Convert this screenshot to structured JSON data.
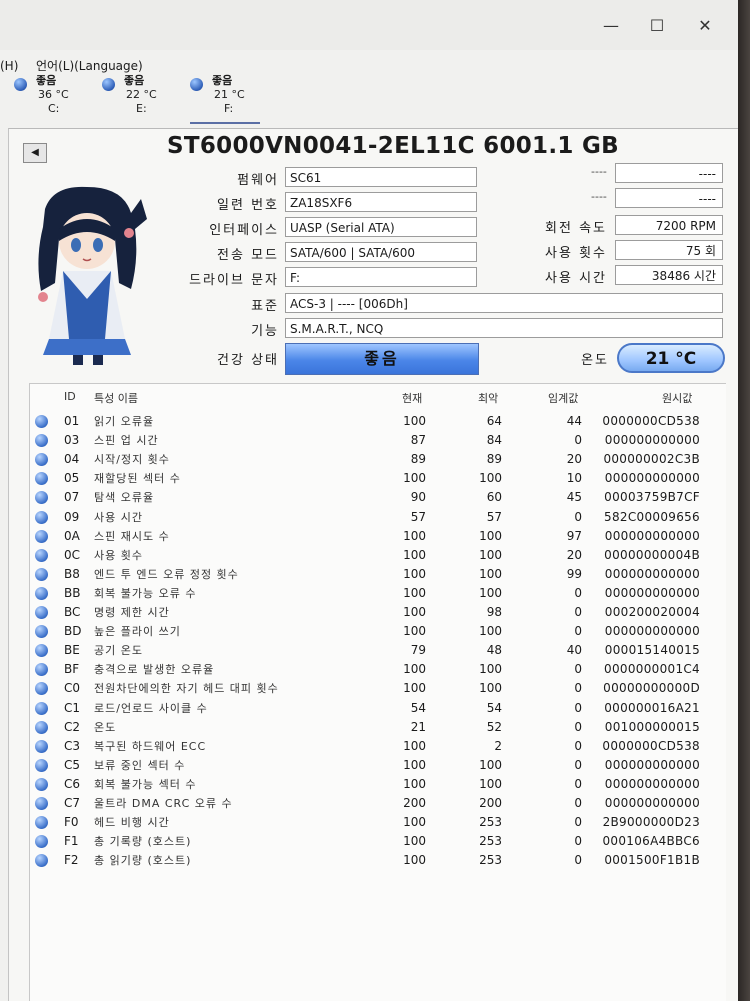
{
  "window": {
    "minimize": "—",
    "maximize": "☐",
    "close": "✕"
  },
  "menu": [
    {
      "label": "(H)"
    },
    {
      "label": "언어(L)(Language)"
    }
  ],
  "drives": [
    {
      "status": "좋음",
      "temp": "36 °C",
      "letter": "C:"
    },
    {
      "status": "좋음",
      "temp": "22 °C",
      "letter": "E:"
    },
    {
      "status": "좋음",
      "temp": "21 °C",
      "letter": "F:"
    }
  ],
  "disk": {
    "title": "ST6000VN0041-2EL11C 6001.1 GB",
    "firmware_label": "펌웨어",
    "firmware": "SC61",
    "serial_label": "일련 번호",
    "serial": "ZA18SXF6",
    "interface_label": "인터페이스",
    "interface": "UASP (Serial ATA)",
    "transfer_label": "전송 모드",
    "transfer": "SATA/600 | SATA/600",
    "drive_letter_label": "드라이브 문자",
    "drive_letter": "F:",
    "standard_label": "표준",
    "standard": "ACS-3 | ---- [006Dh]",
    "features_label": "기능",
    "features": "S.M.A.R.T., NCQ",
    "health_label": "건강 상태",
    "health": "좋음",
    "temp_label": "온도",
    "temp": "21 °C",
    "rpm_label": "회전 속도",
    "rpm": "7200 RPM",
    "power_on_count_label": "사용 횟수",
    "power_on_count": "75 회",
    "power_on_hours_label": "사용 시간",
    "power_on_hours": "38486 시간",
    "blank1_dash": "----",
    "blank1_value": "----",
    "blank2_dash": "----",
    "blank2_value": "----"
  },
  "table": {
    "headers": {
      "id": "ID",
      "name": "특성 이름",
      "current": "현재",
      "worst": "최악",
      "threshold": "임계값",
      "raw": "원시값"
    },
    "rows": [
      {
        "id": "01",
        "name": "읽기 오류율",
        "current": "100",
        "worst": "64",
        "threshold": "44",
        "raw": "0000000CD538"
      },
      {
        "id": "03",
        "name": "스핀 업 시간",
        "current": "87",
        "worst": "84",
        "threshold": "0",
        "raw": "000000000000"
      },
      {
        "id": "04",
        "name": "시작/정지 횟수",
        "current": "89",
        "worst": "89",
        "threshold": "20",
        "raw": "000000002C3B"
      },
      {
        "id": "05",
        "name": "재할당된 섹터 수",
        "current": "100",
        "worst": "100",
        "threshold": "10",
        "raw": "000000000000"
      },
      {
        "id": "07",
        "name": "탐색 오류율",
        "current": "90",
        "worst": "60",
        "threshold": "45",
        "raw": "00003759B7CF"
      },
      {
        "id": "09",
        "name": "사용 시간",
        "current": "57",
        "worst": "57",
        "threshold": "0",
        "raw": "582C00009656"
      },
      {
        "id": "0A",
        "name": "스핀 재시도 수",
        "current": "100",
        "worst": "100",
        "threshold": "97",
        "raw": "000000000000"
      },
      {
        "id": "0C",
        "name": "사용 횟수",
        "current": "100",
        "worst": "100",
        "threshold": "20",
        "raw": "00000000004B"
      },
      {
        "id": "B8",
        "name": "엔드 투 엔드 오류 정정 횟수",
        "current": "100",
        "worst": "100",
        "threshold": "99",
        "raw": "000000000000"
      },
      {
        "id": "BB",
        "name": "회복 불가능 오류 수",
        "current": "100",
        "worst": "100",
        "threshold": "0",
        "raw": "000000000000"
      },
      {
        "id": "BC",
        "name": "명령 제한 시간",
        "current": "100",
        "worst": "98",
        "threshold": "0",
        "raw": "000200020004"
      },
      {
        "id": "BD",
        "name": "높은 플라이 쓰기",
        "current": "100",
        "worst": "100",
        "threshold": "0",
        "raw": "000000000000"
      },
      {
        "id": "BE",
        "name": "공기 온도",
        "current": "79",
        "worst": "48",
        "threshold": "40",
        "raw": "000015140015"
      },
      {
        "id": "BF",
        "name": "충격으로 발생한 오류율",
        "current": "100",
        "worst": "100",
        "threshold": "0",
        "raw": "0000000001C4"
      },
      {
        "id": "C0",
        "name": "전원차단에의한 자기 헤드 대피 횟수",
        "current": "100",
        "worst": "100",
        "threshold": "0",
        "raw": "00000000000D"
      },
      {
        "id": "C1",
        "name": "로드/언로드 사이클 수",
        "current": "54",
        "worst": "54",
        "threshold": "0",
        "raw": "000000016A21"
      },
      {
        "id": "C2",
        "name": "온도",
        "current": "21",
        "worst": "52",
        "threshold": "0",
        "raw": "001000000015"
      },
      {
        "id": "C3",
        "name": "복구된 하드웨어 ECC",
        "current": "100",
        "worst": "2",
        "threshold": "0",
        "raw": "0000000CD538"
      },
      {
        "id": "C5",
        "name": "보류 중인 섹터 수",
        "current": "100",
        "worst": "100",
        "threshold": "0",
        "raw": "000000000000"
      },
      {
        "id": "C6",
        "name": "회복 불가능 섹터 수",
        "current": "100",
        "worst": "100",
        "threshold": "0",
        "raw": "000000000000"
      },
      {
        "id": "C7",
        "name": "울트라 DMA CRC 오류 수",
        "current": "200",
        "worst": "200",
        "threshold": "0",
        "raw": "000000000000"
      },
      {
        "id": "F0",
        "name": "헤드 비행 시간",
        "current": "100",
        "worst": "253",
        "threshold": "0",
        "raw": "2B9000000D23"
      },
      {
        "id": "F1",
        "name": "총 기록량 (호스트)",
        "current": "100",
        "worst": "253",
        "threshold": "0",
        "raw": "000106A4BBC6"
      },
      {
        "id": "F2",
        "name": "총 읽기량 (호스트)",
        "current": "100",
        "worst": "253",
        "threshold": "0",
        "raw": "0001500F1B1B"
      }
    ]
  },
  "colors": {
    "health_blue": "#4b86e8",
    "status_dot": "#2f5fb8"
  }
}
